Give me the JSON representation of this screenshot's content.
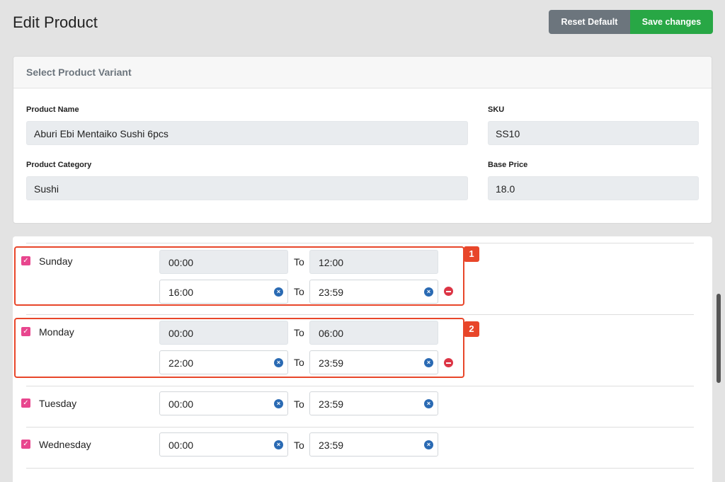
{
  "header": {
    "title": "Edit Product",
    "reset_label": "Reset Default",
    "save_label": "Save changes"
  },
  "variant_card": {
    "title": "Select Product Variant",
    "product_name_label": "Product Name",
    "product_name_value": "Aburi Ebi Mentaiko Sushi 6pcs",
    "sku_label": "SKU",
    "sku_value": "SS10",
    "category_label": "Product Category",
    "category_value": "Sushi",
    "base_price_label": "Base Price",
    "base_price_value": "18.0"
  },
  "schedule": {
    "to_label": "To",
    "days": [
      {
        "name": "Sunday",
        "checked": true,
        "badge": "1",
        "slots": [
          {
            "from": "00:00",
            "to": "12:00",
            "editable": false
          },
          {
            "from": "16:00",
            "to": "23:59",
            "editable": true
          }
        ]
      },
      {
        "name": "Monday",
        "checked": true,
        "badge": "2",
        "slots": [
          {
            "from": "00:00",
            "to": "06:00",
            "editable": false
          },
          {
            "from": "22:00",
            "to": "23:59",
            "editable": true
          }
        ]
      },
      {
        "name": "Tuesday",
        "checked": true,
        "slots": [
          {
            "from": "00:00",
            "to": "23:59",
            "editable": true
          }
        ]
      },
      {
        "name": "Wednesday",
        "checked": true,
        "slots": [
          {
            "from": "00:00",
            "to": "23:59",
            "editable": true
          }
        ]
      }
    ]
  },
  "colors": {
    "checkbox": "#e8468e",
    "save": "#28a745",
    "reset": "#6c757d",
    "highlight": "#e8462a",
    "clear_icon": "#2a6ab3",
    "remove_icon": "#dc3545"
  }
}
